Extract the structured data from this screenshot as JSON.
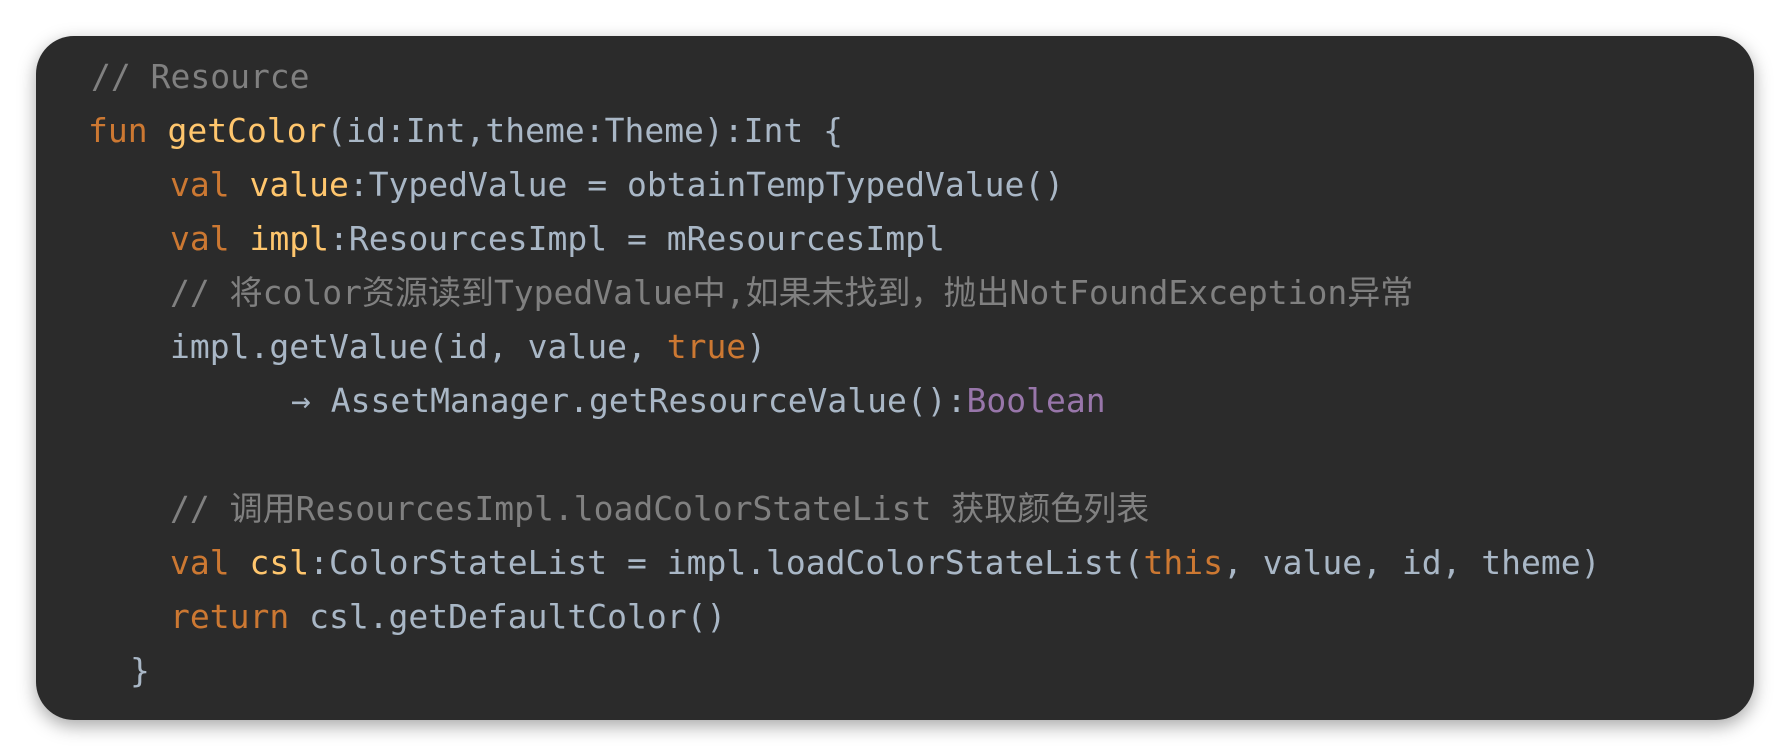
{
  "colors": {
    "background": "#2b2b2b",
    "plain": "#a9b7c6",
    "keyword": "#cc7832",
    "function": "#ffc66d",
    "comment": "#808080",
    "type_purple": "#9876aa"
  },
  "code_lines": [
    {
      "indent": 55,
      "tokens": [
        {
          "text": "// Resource",
          "kind": "comment"
        }
      ]
    },
    {
      "indent": 52,
      "tokens": [
        {
          "text": "fun ",
          "kind": "keyword"
        },
        {
          "text": "getColor",
          "kind": "function"
        },
        {
          "text": "(id:Int,theme:Theme):Int {",
          "kind": "plain"
        }
      ]
    },
    {
      "indent": 134,
      "tokens": [
        {
          "text": "val ",
          "kind": "keyword"
        },
        {
          "text": "value",
          "kind": "function"
        },
        {
          "text": ":TypedValue = obtainTempTypedValue()",
          "kind": "plain"
        }
      ]
    },
    {
      "indent": 134,
      "tokens": [
        {
          "text": "val ",
          "kind": "keyword"
        },
        {
          "text": "impl",
          "kind": "function"
        },
        {
          "text": ":ResourcesImpl = mResourcesImpl",
          "kind": "plain"
        }
      ]
    },
    {
      "indent": 134,
      "tokens": [
        {
          "text": "// 将color资源读到TypedValue中,如果未找到，抛出NotFoundException异常",
          "kind": "comment"
        }
      ]
    },
    {
      "indent": 134,
      "tokens": [
        {
          "text": "impl.getValue(id, value, ",
          "kind": "plain"
        },
        {
          "text": "true",
          "kind": "keyword"
        },
        {
          "text": ")",
          "kind": "plain"
        }
      ]
    },
    {
      "indent": 255,
      "tokens": [
        {
          "text": "→ AssetManager.getResourceValue():",
          "kind": "plain"
        },
        {
          "text": "Boolean",
          "kind": "type_purple"
        }
      ]
    },
    {
      "indent": 0,
      "tokens": []
    },
    {
      "indent": 134,
      "tokens": [
        {
          "text": "// 调用ResourcesImpl.loadColorStateList 获取颜色列表",
          "kind": "comment"
        }
      ]
    },
    {
      "indent": 134,
      "tokens": [
        {
          "text": "val ",
          "kind": "keyword"
        },
        {
          "text": "csl",
          "kind": "function"
        },
        {
          "text": ":ColorStateList = impl.loadColorStateList(",
          "kind": "plain"
        },
        {
          "text": "this",
          "kind": "keyword"
        },
        {
          "text": ", value, id, theme)",
          "kind": "plain"
        }
      ]
    },
    {
      "indent": 134,
      "tokens": [
        {
          "text": "return ",
          "kind": "keyword"
        },
        {
          "text": "csl.getDefaultColor()",
          "kind": "plain"
        }
      ]
    },
    {
      "indent": 94,
      "tokens": [
        {
          "text": "}",
          "kind": "plain"
        }
      ]
    }
  ]
}
